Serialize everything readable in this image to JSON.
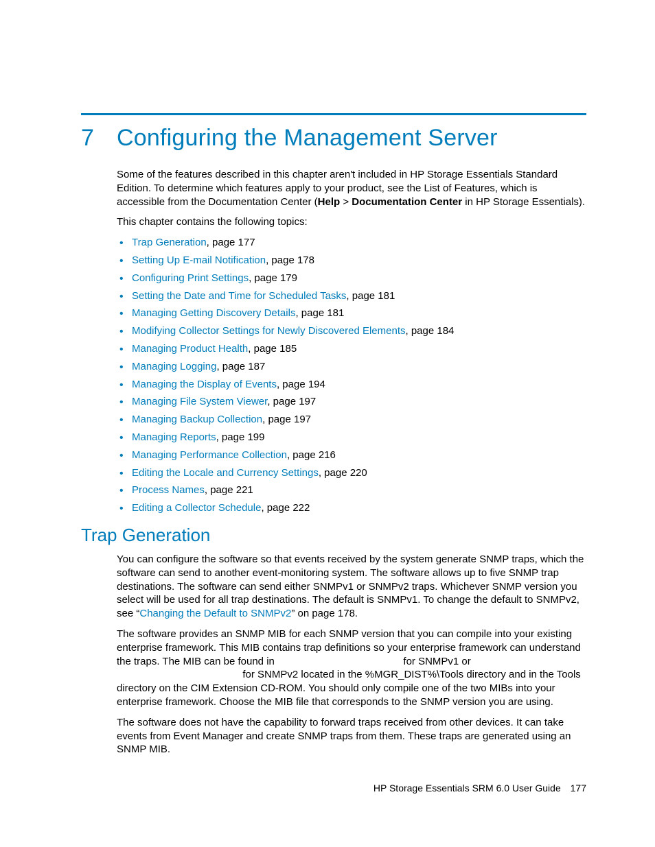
{
  "chapter": {
    "number": "7",
    "title": "Configuring the Management Server"
  },
  "intro": {
    "p1a": "Some of the features described in this chapter aren't included in HP Storage Essentials Standard Edition. To determine which features apply to your product, see the List of Features, which is accessible from the Documentation Center (",
    "p1b": "Help",
    "p1c": " > ",
    "p1d": "Documentation Center",
    "p1e": " in HP Storage Essentials).",
    "p2": "This chapter contains the following topics:"
  },
  "toc": [
    {
      "link": "Trap Generation",
      "suffix": ", page 177"
    },
    {
      "link": "Setting Up E-mail Notification",
      "suffix": ", page 178"
    },
    {
      "link": "Configuring Print Settings",
      "suffix": ", page 179"
    },
    {
      "link": "Setting the Date and Time for Scheduled Tasks",
      "suffix": ", page 181"
    },
    {
      "link": "Managing Getting Discovery Details",
      "suffix": ", page 181"
    },
    {
      "link": "Modifying Collector Settings for Newly Discovered Elements",
      "suffix": ", page 184"
    },
    {
      "link": "Managing Product Health",
      "suffix": ", page 185"
    },
    {
      "link": "Managing Logging",
      "suffix": ", page 187"
    },
    {
      "link": "Managing the Display of Events",
      "suffix": ", page 194"
    },
    {
      "link": "Managing File System Viewer",
      "suffix": ", page 197"
    },
    {
      "link": "Managing Backup Collection",
      "suffix": ", page 197"
    },
    {
      "link": "Managing Reports",
      "suffix": ", page 199"
    },
    {
      "link": "Managing Performance Collection",
      "suffix": ", page 216"
    },
    {
      "link": "Editing the Locale and Currency Settings",
      "suffix": ", page 220"
    },
    {
      "link": "Process Names",
      "suffix": ", page 221"
    },
    {
      "link": "Editing a Collector Schedule",
      "suffix": ", page 222"
    }
  ],
  "section": {
    "title": "Trap Generation",
    "p1a": "You can configure the software so that events received by the system generate SNMP traps, which the software can send to another event-monitoring system. The software allows up to five SNMP trap destinations. The software can send either SNMPv1 or SNMPv2 traps. Whichever SNMP version you select will be used for all trap destinations. The default is SNMPv1. To change the default to SNMPv2, see “",
    "p1link": "Changing the Default to SNMPv2",
    "p1b": "” on page 178.",
    "p2": "The software provides an SNMP MIB for each SNMP version that you can compile into your existing enterprise framework. This MIB contains trap definitions so your enterprise framework can understand the traps. The MIB can be found in                                             for SNMPv1 or                                             for SNMPv2 located in the %MGR_DIST%\\Tools directory and in the Tools directory on the CIM Extension CD-ROM. You should only compile one of the two MIBs into your enterprise framework. Choose the MIB file that corresponds to the SNMP version you are using.",
    "p3": "The software does not have the capability to forward traps received from other devices. It can take events from Event Manager and create SNMP traps from them. These traps are generated using an SNMP MIB."
  },
  "footer": {
    "text": "HP Storage Essentials SRM 6.0 User Guide",
    "page": "177"
  }
}
